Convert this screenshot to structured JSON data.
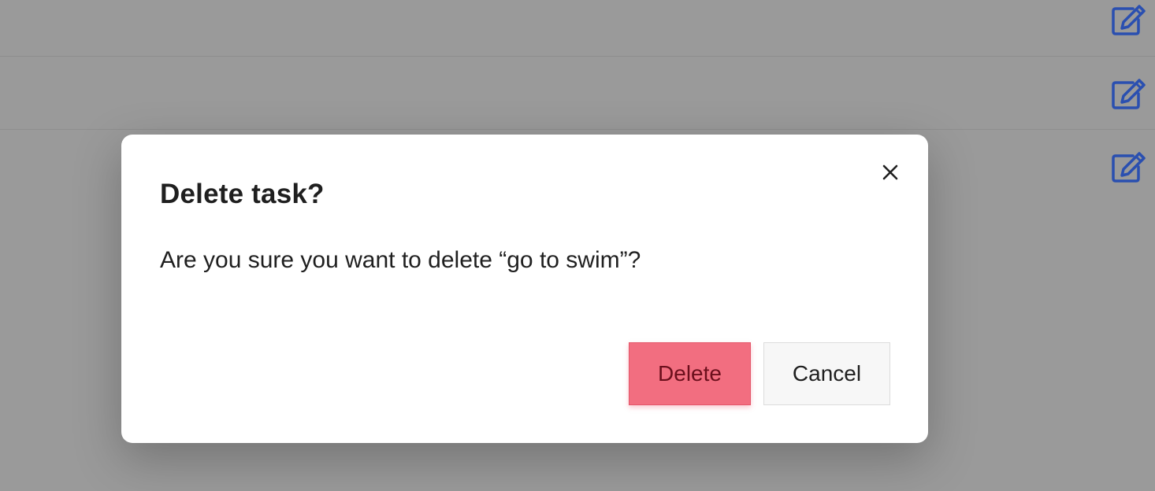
{
  "colors": {
    "overlay": "#9a9a9a",
    "accent_icon": "#2a4fb0",
    "danger": "#f26e80",
    "modal_bg": "#ffffff"
  },
  "task_list": {
    "rows": [
      {
        "edit_icon": "edit-icon"
      },
      {
        "edit_icon": "edit-icon"
      },
      {
        "edit_icon": "edit-icon"
      }
    ]
  },
  "dialog": {
    "title": "Delete task?",
    "message": "Are you sure you want to delete “go to swim”?",
    "close_icon": "close-icon",
    "delete_label": "Delete",
    "cancel_label": "Cancel"
  }
}
